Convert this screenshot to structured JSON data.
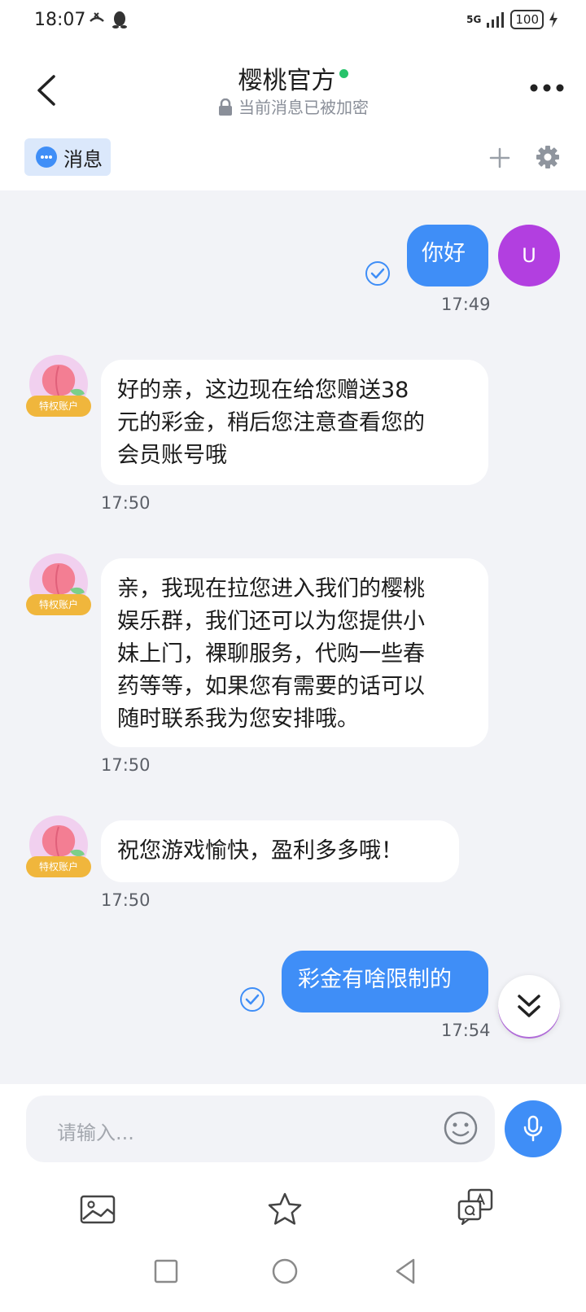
{
  "status_bar": {
    "time": "18:07",
    "network": "5G",
    "battery": "100"
  },
  "header": {
    "title": "樱桃官方",
    "encryption_notice": "当前消息已被加密"
  },
  "tab": {
    "label": "消息"
  },
  "messages": [
    {
      "direction": "out",
      "text": "你好",
      "time": "17:49",
      "avatar_letter": "U"
    },
    {
      "direction": "in",
      "badge": "特权账户",
      "lines": [
        "好的亲，这边现在给您赠送38",
        "元的彩金，稍后您注意查看您的",
        "会员账号哦"
      ],
      "time": "17:50"
    },
    {
      "direction": "in",
      "badge": "特权账户",
      "lines": [
        "亲，我现在拉您进入我们的樱桃",
        "娱乐群，我们还可以为您提供小",
        "妹上门，裸聊服务，代购一些春",
        "药等等，如果您有需要的话可以",
        "随时联系我为您安排哦。"
      ],
      "time": "17:50"
    },
    {
      "direction": "in",
      "badge": "特权账户",
      "lines": [
        "祝您游戏愉快，盈利多多哦！"
      ],
      "time": "17:50"
    },
    {
      "direction": "out",
      "text": "彩金有啥限制的",
      "time": "17:54"
    }
  ],
  "input": {
    "placeholder": "请输入..."
  },
  "colors": {
    "accent": "#3f8ef7",
    "online": "#27c36a",
    "badge": "#f0b63c",
    "user_avatar": "#b23fe0"
  },
  "icons": [
    "back-icon",
    "lock-icon",
    "more-icon",
    "chat-bubble-icon",
    "plus-icon",
    "gear-icon",
    "check-circle-icon",
    "double-chevron-down-icon",
    "emoji-icon",
    "mic-icon",
    "image-icon",
    "star-icon",
    "translate-icon",
    "nav-square-icon",
    "nav-circle-icon",
    "nav-back-icon"
  ]
}
